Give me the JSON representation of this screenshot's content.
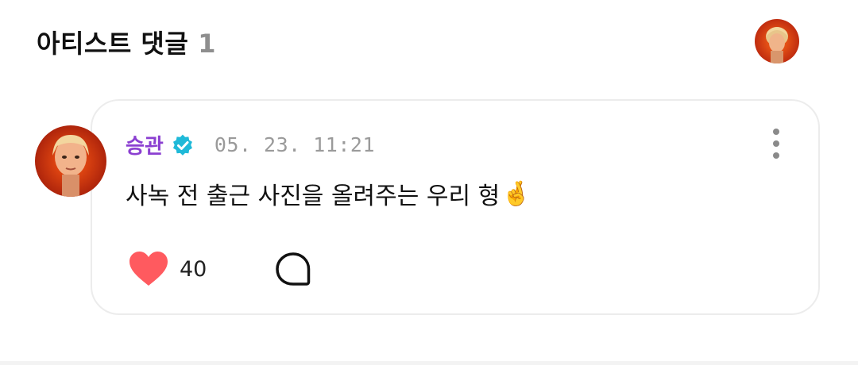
{
  "section": {
    "title": "아티스트 댓글",
    "count": "1"
  },
  "comment": {
    "author": "승관",
    "timestamp": "05. 23. 11:21",
    "text": "사녹 전 출근 사진을 올려주는 우리 형",
    "emoji": "🤞",
    "likes": "40",
    "liked": true
  },
  "icons": {
    "header_avatar": "artist-avatar",
    "comment_avatar": "artist-avatar",
    "verified": "verified-badge-icon",
    "more": "more-vertical-icon",
    "like": "heart-icon",
    "reply": "speech-bubble-icon"
  },
  "colors": {
    "author": "#8b3fd1",
    "verified": "#1fb9d8",
    "heart": "#ff5a5f",
    "timestamp": "#9a9a9a",
    "count": "#8e8e8e"
  }
}
